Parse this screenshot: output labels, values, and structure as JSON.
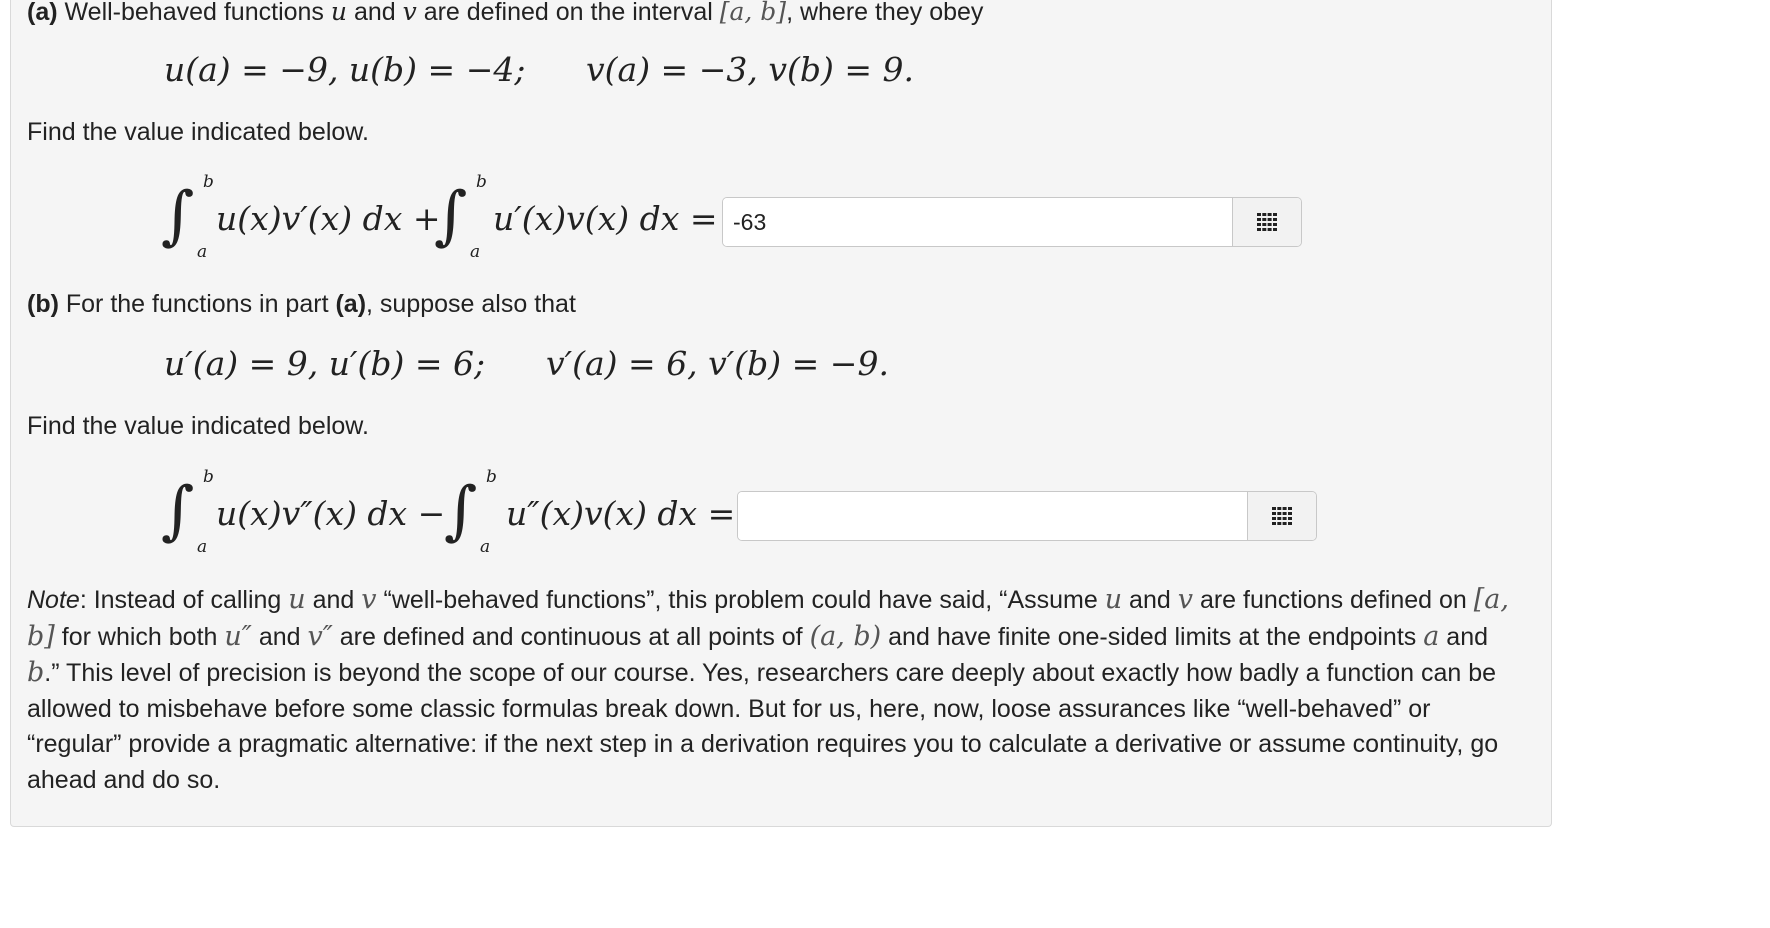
{
  "part_a": {
    "label": "(a)",
    "intro": "Well-behaved functions",
    "var_u": "u",
    "and": "and",
    "var_v": "v",
    "intro_mid": "are defined on the interval",
    "interval": "[a, b]",
    "intro_end": ", where they obey",
    "conditions_u": "u(a) = −9,  u(b) = −4;",
    "conditions_v": "v(a) = −3,  v(b) = 9.",
    "find": "Find the value indicated below.",
    "integral1": "u(x)v′(x) dx +",
    "integral2": "u′(x)v(x) dx =",
    "answer_value": "-63"
  },
  "part_b": {
    "label": "(b)",
    "intro": "For the functions in part",
    "ref": "(a)",
    "intro_end": ", suppose also that",
    "conditions_u": "u′(a) = 9,  u′(b) = 6;",
    "conditions_v": "v′(a) = 6,  v′(b) = −9.",
    "find": "Find the value indicated below.",
    "integral1": "u(x)v″(x) dx −",
    "integral2": "u″(x)v(x) dx =",
    "answer_value": ""
  },
  "limits": {
    "upper": "b",
    "lower": "a"
  },
  "note": {
    "label": "Note",
    "t1": ": Instead of calling",
    "u": "u",
    "and": "and",
    "v": "v",
    "t2": "“well-behaved functions”, this problem could have said, “Assume",
    "t3": "are functions defined on",
    "interval": "[a, b]",
    "t4": "for which both",
    "upp": "u″",
    "vpp": "v″",
    "t5": "are defined and continuous at all points of",
    "open_interval": "(a, b)",
    "t6": "and have finite one-sided limits at the endpoints",
    "a": "a",
    "b": "b",
    "t7": ".” This level of precision is beyond the scope of our course. Yes, researchers care deeply about exactly how badly a function can be allowed to misbehave before some classic formulas break down. But for us, here, now, loose assurances like “well-behaved” or “regular” provide a pragmatic alternative: if the next step in a derivation requires you to calculate a derivative or assume continuity, go ahead and do so."
  },
  "icons": {
    "matrix_button": "matrix-grid-icon"
  }
}
